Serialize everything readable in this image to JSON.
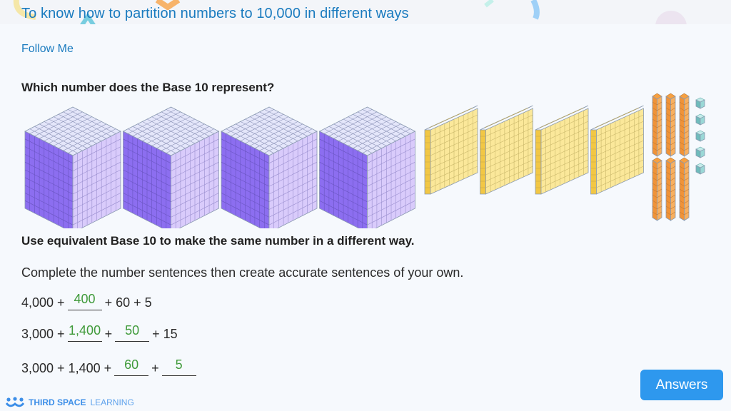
{
  "header": {
    "title": "To know how to partition numbers to 10,000 in different ways"
  },
  "section_label": "Follow Me",
  "question_1": "Which number does the Base 10 represent?",
  "base10": {
    "thousands": 4,
    "hundreds": 4,
    "tens": 6,
    "ones": 5,
    "colors": {
      "thousand": "#8c6ef0",
      "hundred": "#f7df6a",
      "ten": "#f5a04a",
      "one": "#7fc8c8"
    }
  },
  "question_2": "Use equivalent Base 10 to make the same number in a different way.",
  "instruction": "Complete the number sentences then create accurate sentences of your own.",
  "equations": [
    {
      "parts": [
        "4,000 +",
        {
          "answer": "400"
        },
        "+ 60 + 5"
      ]
    },
    {
      "parts": [
        "3,000 +",
        {
          "answer": "1,400"
        },
        "+",
        {
          "answer": "50"
        },
        "+ 15"
      ]
    },
    {
      "parts": [
        "3,000 + 1,400 +",
        {
          "answer": "60"
        },
        "+",
        {
          "answer": "5"
        }
      ]
    }
  ],
  "answers_button": "Answers",
  "logo": {
    "bold": "THIRD SPACE",
    "light": "LEARNING"
  }
}
